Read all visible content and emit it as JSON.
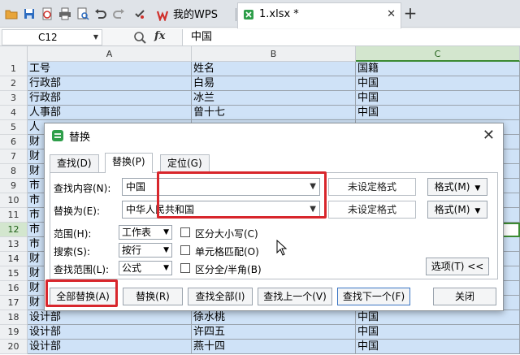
{
  "tabs": [
    {
      "label": "我的WPS",
      "active": false
    },
    {
      "label": "1.xlsx *",
      "active": true
    }
  ],
  "formula_bar": {
    "cell_ref": "C12",
    "fx": "fx",
    "value": "中国"
  },
  "columns": [
    "A",
    "B",
    "C"
  ],
  "rows": [
    {
      "num": "1",
      "a": "工号",
      "b": "姓名",
      "c": "国籍"
    },
    {
      "num": "2",
      "a": "行政部",
      "b": "白易",
      "c": "中国"
    },
    {
      "num": "3",
      "a": "行政部",
      "b": "冰兰",
      "c": "中国"
    },
    {
      "num": "4",
      "a": "人事部",
      "b": "曾十七",
      "c": "中国"
    },
    {
      "num": "5",
      "a": "人",
      "b": "",
      "c": ""
    },
    {
      "num": "6",
      "a": "财",
      "b": "",
      "c": ""
    },
    {
      "num": "7",
      "a": "财",
      "b": "",
      "c": ""
    },
    {
      "num": "8",
      "a": "财",
      "b": "",
      "c": ""
    },
    {
      "num": "9",
      "a": "市",
      "b": "",
      "c": ""
    },
    {
      "num": "10",
      "a": "市",
      "b": "",
      "c": ""
    },
    {
      "num": "11",
      "a": "市",
      "b": "",
      "c": ""
    },
    {
      "num": "12",
      "a": "市",
      "b": "",
      "c": ""
    },
    {
      "num": "13",
      "a": "市",
      "b": "",
      "c": ""
    },
    {
      "num": "14",
      "a": "财",
      "b": "",
      "c": ""
    },
    {
      "num": "15",
      "a": "财",
      "b": "",
      "c": ""
    },
    {
      "num": "16",
      "a": "财",
      "b": "",
      "c": ""
    },
    {
      "num": "17",
      "a": "财",
      "b": "",
      "c": ""
    },
    {
      "num": "18",
      "a": "设计部",
      "b": "徐水桃",
      "c": "中国"
    },
    {
      "num": "19",
      "a": "设计部",
      "b": "许四五",
      "c": "中国"
    },
    {
      "num": "20",
      "a": "设计部",
      "b": "燕十四",
      "c": "中国"
    }
  ],
  "dialog": {
    "title": "替换",
    "tabs": [
      "查找(D)",
      "替换(P)",
      "定位(G)"
    ],
    "find_label": "查找内容(N):",
    "find_value": "中国",
    "replace_label": "替换为(E):",
    "replace_value": "中华人民共和国",
    "no_format": "未设定格式",
    "format_btn": "格式(M)",
    "scope_label": "范围(H):",
    "scope_value": "工作表",
    "search_label": "搜索(S):",
    "search_value": "按行",
    "lookin_label": "查找范围(L):",
    "lookin_value": "公式",
    "match_case": "区分大小写(C)",
    "match_cell": "单元格匹配(O)",
    "match_width": "区分全/半角(B)",
    "options_btn": "选项(T) <<",
    "replace_all": "全部替换(A)",
    "replace": "替换(R)",
    "find_all": "查找全部(I)",
    "find_prev": "查找上一个(V)",
    "find_next": "查找下一个(F)",
    "close": "关闭"
  }
}
